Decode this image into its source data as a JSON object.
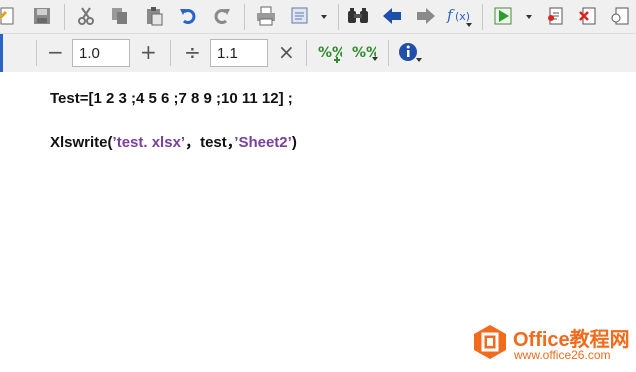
{
  "toolbar1": {
    "icons": [
      "document-icon",
      "save-icon",
      "cut-icon",
      "copy-icon",
      "paste-icon",
      "undo-icon",
      "redo-icon",
      "print-icon",
      "print-preview-icon",
      "find-icon",
      "back-arrow-icon",
      "forward-arrow-icon",
      "function-icon",
      "run-icon",
      "publish-icon",
      "clear-icon",
      "close-document-icon"
    ]
  },
  "toolbar2": {
    "minus_label": "−",
    "first_value": "1.0",
    "plus_label": "+",
    "divide_label": "÷",
    "second_value": "1.1",
    "times_label": "×"
  },
  "code": {
    "line1": "Test=[1 2 3 ;4 5 6 ;7 8 9 ;10 11 12] ;",
    "line2": {
      "p1": "Xlswrite(",
      "q1": "’",
      "s1": "test. xlsx",
      "q2": "’",
      "p2": "，test，",
      "q3": "’",
      "s2": "Sheet2",
      "q4": "’",
      "p3": ")"
    }
  },
  "watermark": {
    "brand_text": "Office教程网",
    "url_text": "www.office26.com",
    "color": "#f26b1d"
  }
}
